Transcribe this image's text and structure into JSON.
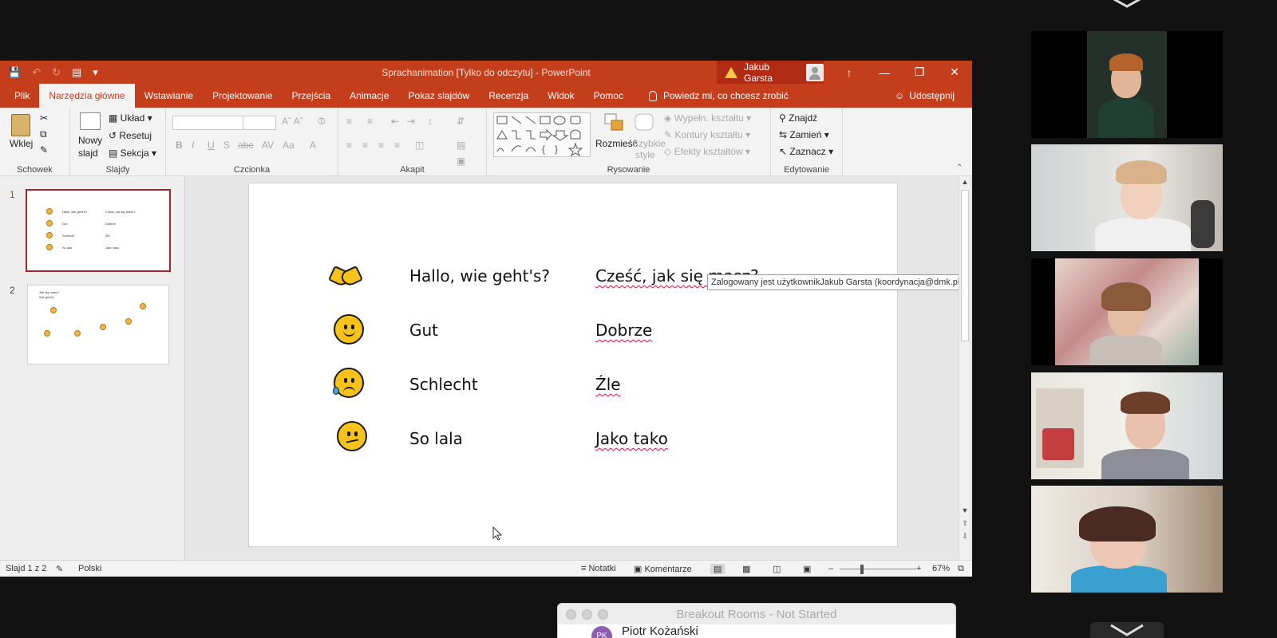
{
  "window": {
    "title": "Sprachanimation [Tylko do odczytu]  -  PowerPoint",
    "user_name": "Jakub Garsta",
    "controls": [
      "↑",
      "—",
      "❐",
      "✕"
    ]
  },
  "tabs": [
    "Plik",
    "Narzędzia główne",
    "Wstawianie",
    "Projektowanie",
    "Przejścia",
    "Animacje",
    "Pokaz slajdów",
    "Recenzja",
    "Widok",
    "Pomoc"
  ],
  "active_tab": "Narzędzia główne",
  "tell_me": "Powiedz mi, co chcesz zrobić",
  "share": "Udostępnij",
  "ribbon": {
    "schowek": {
      "label": "Schowek",
      "paste": "Wklej"
    },
    "slajdy": {
      "label": "Slajdy",
      "new_slide_1": "Nowy",
      "new_slide_2": "slajd",
      "layout": "Układ",
      "reset": "Resetuj",
      "section": "Sekcja"
    },
    "czcionka": {
      "label": "Czcionka"
    },
    "akapit": {
      "label": "Akapit"
    },
    "rysowanie": {
      "label": "Rysowanie",
      "arrange": "Rozmieść",
      "quick_styles_1": "Szybkie",
      "quick_styles_2": "style",
      "fill": "Wypełn. kształtu",
      "outline": "Kontury kształtu",
      "effects": "Efekty kształtów"
    },
    "edytowanie": {
      "label": "Edytowanie",
      "find": "Znajdź",
      "replace": "Zamień",
      "select": "Zaznacz"
    }
  },
  "thumbnails": [
    {
      "num": "1",
      "lines": [
        [
          "Hallo, wie geht's?",
          "Cześć, jak się masz?"
        ],
        [
          "Gut",
          "Dobrze"
        ],
        [
          "Schlecht",
          "Źle"
        ],
        [
          "So lala",
          "Jako tako"
        ]
      ]
    },
    {
      "num": "2",
      "lines": [
        [
          "Jak się masz?"
        ],
        [
          "Wie geht's"
        ]
      ]
    }
  ],
  "slide": {
    "rows": [
      {
        "icon": "handshake-icon",
        "de": "Hallo, wie geht's?",
        "pl": "Cześć, jak się masz?"
      },
      {
        "icon": "smiling-face-icon",
        "de": "Gut",
        "pl": "Dobrze"
      },
      {
        "icon": "crying-face-icon",
        "de": "Schlecht",
        "pl": "Źle"
      },
      {
        "icon": "confused-face-icon",
        "de": "So lala",
        "pl": "Jako tako"
      }
    ]
  },
  "tooltip": "Zalogowany jest użytkownikJakub Garsta (koordynacja@dmk.pl)",
  "status": {
    "slide_count": "Slajd 1 z 2",
    "language": "Polski",
    "notes": "Notatki",
    "comments": "Komentarze",
    "zoom": "67%"
  },
  "breakout": {
    "title": "Breakout Rooms - Not Started",
    "initials": "PK",
    "participant": "Piotr Kożański"
  },
  "colors": {
    "ppt_accent": "#c43e1c",
    "emoji_yellow": "#f7c21a"
  }
}
